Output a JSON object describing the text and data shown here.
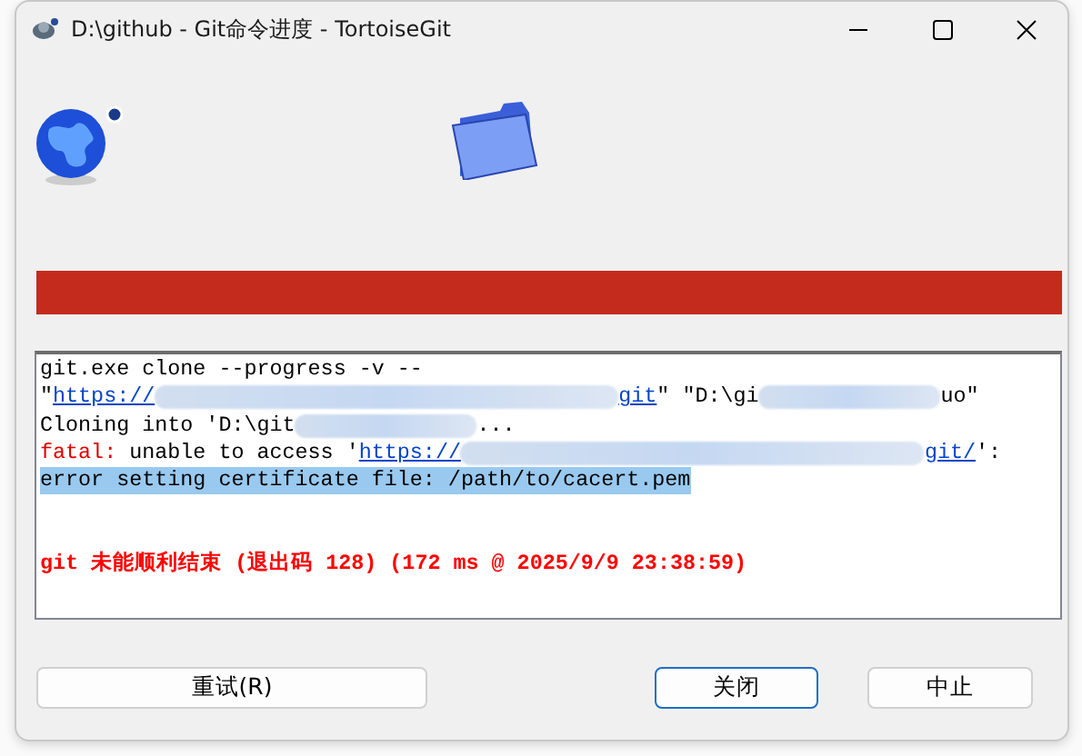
{
  "window": {
    "title": "D:\\github - Git命令进度 - TortoiseGit"
  },
  "progress": {
    "kind": "error",
    "level": 1
  },
  "log": [
    {
      "selected": false,
      "segments": [
        {
          "kind": "text",
          "text": "git.exe clone --progress -v --"
        }
      ]
    },
    {
      "selected": false,
      "segments": [
        {
          "kind": "text",
          "text": "\""
        },
        {
          "kind": "link",
          "text": "https://"
        },
        {
          "kind": "redacted"
        },
        {
          "kind": "link",
          "text": "git"
        },
        {
          "kind": "text",
          "text": "\" \"D:\\gi"
        },
        {
          "kind": "redacted"
        },
        {
          "kind": "text",
          "text": "uo\""
        }
      ]
    },
    {
      "selected": false,
      "segments": [
        {
          "kind": "text",
          "text": "Cloning into 'D:\\git"
        },
        {
          "kind": "redacted"
        },
        {
          "kind": "text",
          "text": "..."
        }
      ]
    },
    {
      "selected": false,
      "segments": [
        {
          "kind": "error",
          "text": "fatal:"
        },
        {
          "kind": "text",
          "text": " unable to access '"
        },
        {
          "kind": "link",
          "text": "https://"
        },
        {
          "kind": "redacted"
        },
        {
          "kind": "link",
          "text": "git/"
        },
        {
          "kind": "text",
          "text": "':"
        }
      ]
    },
    {
      "selected": true,
      "segments": [
        {
          "kind": "text",
          "text": "error setting certificate file: /path/to/cacert.pem"
        }
      ]
    },
    {
      "selected": false,
      "segments": [
        {
          "kind": "result",
          "text": "git 未能顺利结束 (退出码 128) (172 ms @ 2025/9/9 23:38:59)"
        }
      ]
    }
  ],
  "buttons": [
    {
      "kind": "retry",
      "label": "重试(R)",
      "default": false
    },
    {
      "kind": "close",
      "label": "关闭",
      "default": true
    },
    {
      "kind": "abort",
      "label": "中止",
      "default": false
    }
  ]
}
